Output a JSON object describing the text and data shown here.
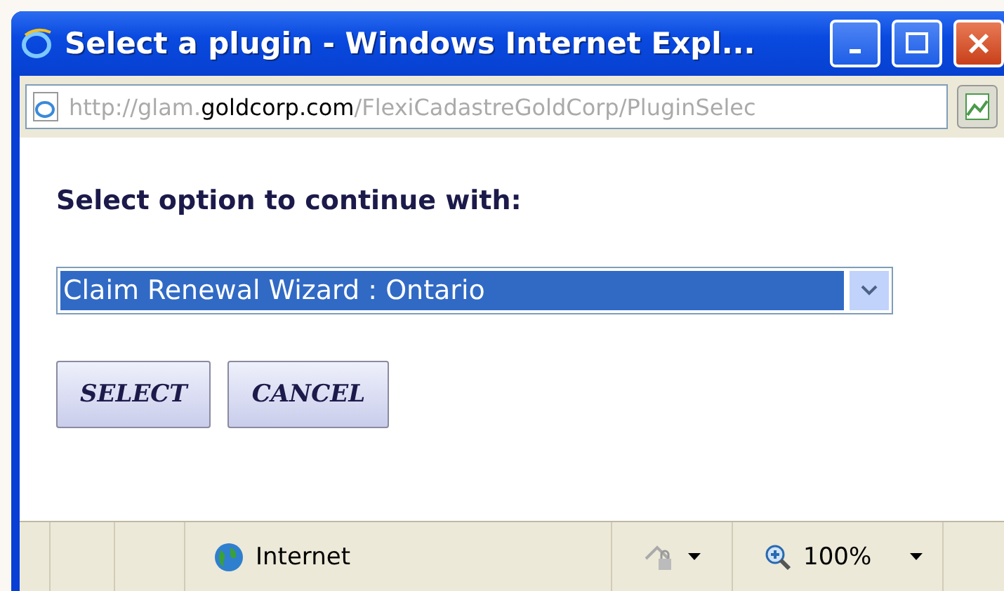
{
  "window": {
    "title": "Select a plugin - Windows Internet Expl..."
  },
  "address_bar": {
    "url_prefix": "http://glam.",
    "url_domain": "goldcorp.com",
    "url_path": "/FlexiCadastreGoldCorp/PluginSelec"
  },
  "heading": "Select option to continue with:",
  "dropdown": {
    "value": "Claim Renewal Wizard : Ontario",
    "focused": true
  },
  "buttons": [
    "SELECT",
    "CANCEL"
  ],
  "status_bar": {
    "zone": "Internet",
    "zoom": "100%"
  }
}
